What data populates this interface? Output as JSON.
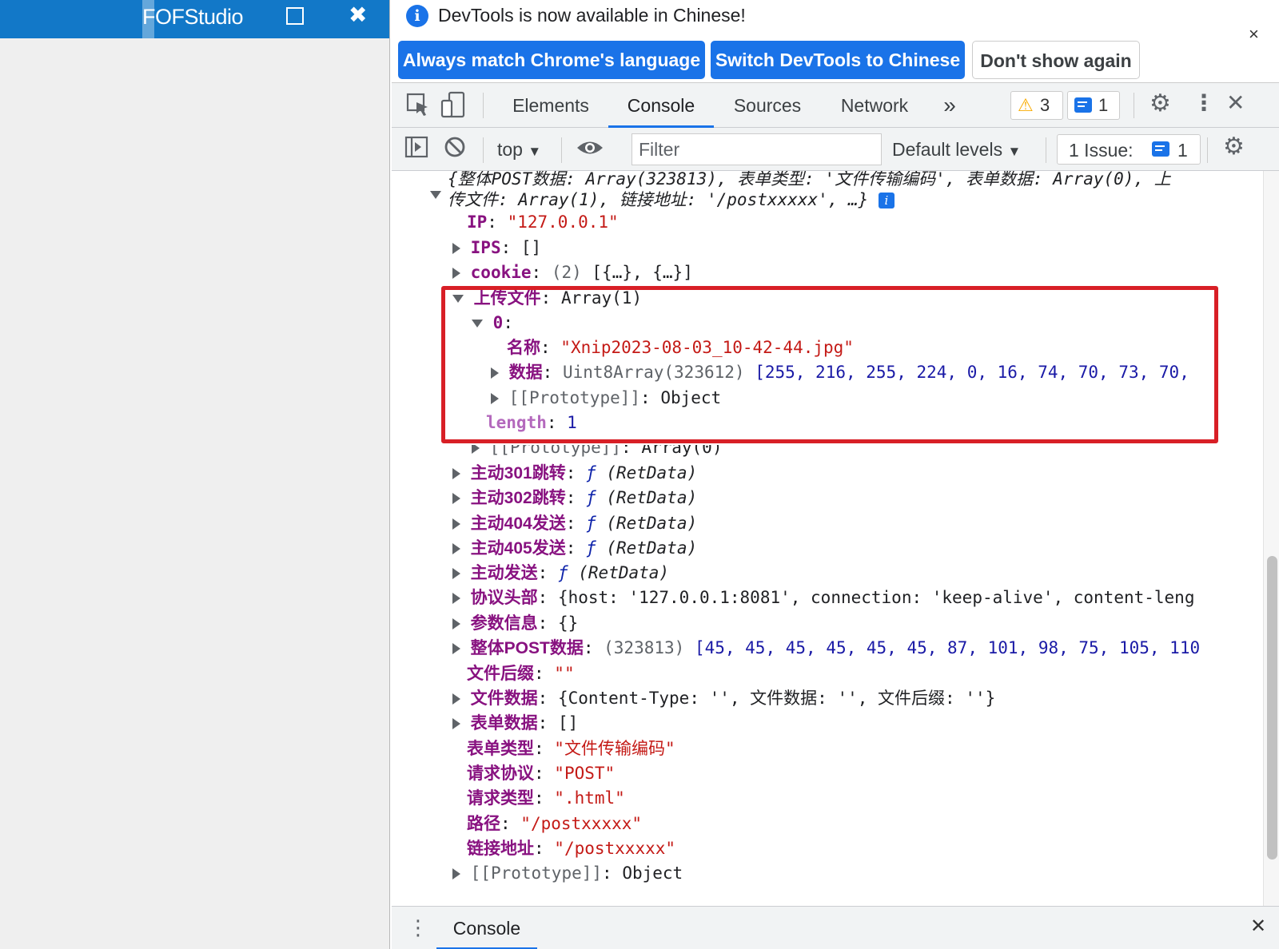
{
  "app": {
    "title": "FOFStudio",
    "maximize_icon": "square-icon",
    "close_icon": "x-icon"
  },
  "banner": {
    "message": "DevTools is now available in Chinese!",
    "buttons": [
      "Always match Chrome's language",
      "Switch DevTools to Chinese",
      "Don't show again"
    ],
    "close": "×"
  },
  "tabs": {
    "items": [
      "Elements",
      "Console",
      "Sources",
      "Network"
    ],
    "active": "Console",
    "more": "»",
    "warnings": "3",
    "messages": "1",
    "close": "✕"
  },
  "console_toolbar": {
    "context": "top",
    "filter_placeholder": "Filter",
    "levels": "Default levels",
    "issues_label": "1 Issue:",
    "issues_count": "1"
  },
  "output": {
    "summary_1": "{整体POST数据: Array(323813), 表单类型: '文件传输编码', 表单数据: Array(0), 上",
    "summary_2": "传文件: Array(1), 链接地址: '/postxxxxx', …}",
    "ip_key": "IP",
    "ip_val": "\"127.0.0.1\"",
    "ips_key": "IPS",
    "ips_val": "[]",
    "cookie_key": "cookie",
    "cookie_count": "(2)",
    "cookie_val": "[{…}, {…}]",
    "upload_key": "上传文件",
    "upload_val": "Array(1)",
    "idx0": "0",
    "name_key": "名称",
    "name_val": "\"Xnip2023-08-03_10-42-44.jpg\"",
    "data_key": "数据",
    "data_type": "Uint8Array(323612)",
    "data_vals": "[255, 216, 255, 224, 0, 16, 74, 70, 73, 70,",
    "proto_inner": "[[Prototype]]",
    "proto_inner_val": "Object",
    "length_key": "length",
    "length_val": "1",
    "proto_arr": "[[Prototype]]",
    "proto_arr_val": "Array(0)",
    "m301": "主动301跳转",
    "m302": "主动302跳转",
    "m404": "主动404发送",
    "m405": "主动405发送",
    "msend": "主动发送",
    "fn_sig": "(RetData)",
    "headers_key": "协议头部",
    "headers_val": "{host: '127.0.0.1:8081', connection: 'keep-alive', content-leng",
    "params_key": "参数信息",
    "params_val": "{}",
    "post_key": "整体POST数据",
    "post_count": "(323813)",
    "post_vals": "[45, 45, 45, 45, 45, 45, 87, 101, 98, 75, 105, 110",
    "suffix_key": "文件后缀",
    "suffix_val": "\"\"",
    "filedata_key": "文件数据",
    "filedata_val": "{Content-Type: '', 文件数据: '', 文件后缀: ''}",
    "form_key": "表单数据",
    "form_val": "[]",
    "formtype_key": "表单类型",
    "formtype_val": "\"文件传输编码\"",
    "proto_key": "请求协议",
    "proto_val": "\"POST\"",
    "reqtype_key": "请求类型",
    "reqtype_val": "\".html\"",
    "path_key": "路径",
    "path_val": "\"/postxxxxx\"",
    "link_key": "链接地址",
    "link_val": "\"/postxxxxx\"",
    "proto_obj": "[[Prototype]]",
    "proto_obj_val": "Object"
  },
  "drawer": {
    "tab": "Console",
    "close": "✕"
  },
  "colors": {
    "accent": "#1a73e8",
    "app_bar": "#1278c8",
    "highlight_box": "#d81f26",
    "key": "#881280",
    "string": "#c41a16",
    "number": "#1a1aa6"
  }
}
